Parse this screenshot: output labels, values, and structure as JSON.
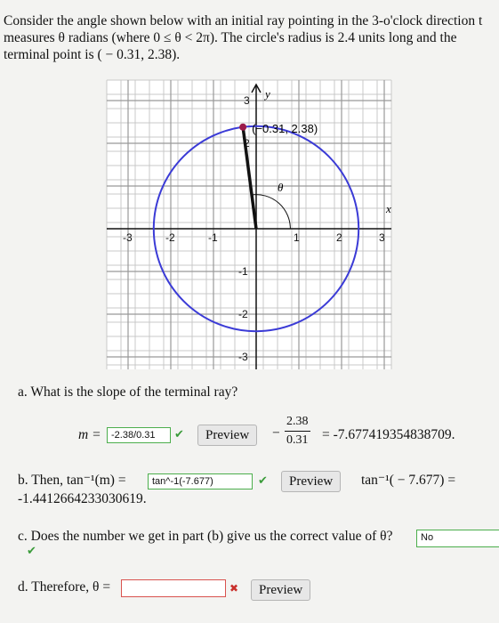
{
  "intro": {
    "line1": "Consider the angle shown below with an initial ray pointing in the 3-o'clock direction t",
    "line2": "measures θ radians (where 0 ≤ θ < 2π). The circle's radius is 2.4 units long and the",
    "line3": "terminal point is ( − 0.31, 2.38)."
  },
  "graph": {
    "x_axis_label": "x",
    "y_axis_label": "y",
    "point_label": "(−0.31, 2.38)",
    "angle_label": "θ",
    "circle_radius": 2.4,
    "terminal_point": [
      -0.31,
      2.38
    ],
    "x_tick_labels": [
      "-3",
      "-2",
      "-1",
      "1",
      "2",
      "3"
    ],
    "y_tick_labels": [
      "3",
      "2",
      "-1",
      "-2",
      "-3"
    ],
    "circle_color": "#3b3bd6",
    "terminal_ray_color": "#111111",
    "point_color": "#9b1b4a"
  },
  "part_a": {
    "question": "a. What is the slope of the terminal ray?",
    "m_label": "m =",
    "answer": "-2.38/0.31",
    "preview_label": "Preview",
    "frac_sign": "−",
    "frac_num": "2.38",
    "frac_den": "0.31",
    "result": "= -7.677419354838709."
  },
  "part_b": {
    "prefix": "b. Then, tan⁻¹(m) =",
    "answer": "tan^-1(-7.677)",
    "preview_label": "Preview",
    "result_expr": "tan⁻¹( − 7.677) =",
    "result_value": "-1.4412664233030619."
  },
  "part_c": {
    "question": "c. Does the number we get in part (b) give us the correct value of θ?",
    "answer": "No"
  },
  "part_d": {
    "prefix": "d. Therefore, θ =",
    "answer": "",
    "preview_label": "Preview"
  }
}
